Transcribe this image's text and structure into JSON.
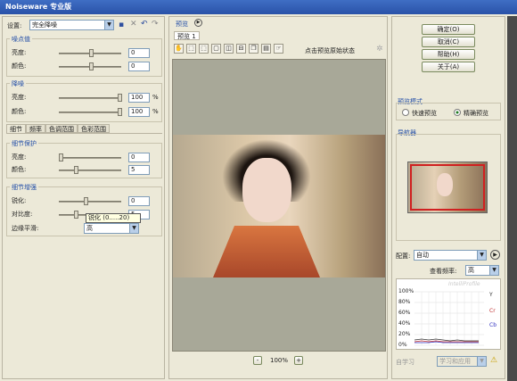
{
  "window": {
    "title": "Noiseware 专业版"
  },
  "settings": {
    "label": "设置:",
    "preset": "完全降噪"
  },
  "threshold": {
    "title": "噪点值",
    "brightness_label": "亮度:",
    "brightness_value": "0",
    "color_label": "颜色:",
    "color_value": "0"
  },
  "denoise": {
    "title": "降噪",
    "brightness_label": "亮度:",
    "brightness_value": "100",
    "brightness_unit": "%",
    "color_label": "颜色:",
    "color_value": "100",
    "color_unit": "%"
  },
  "tabs": [
    "细节",
    "频率",
    "色调范围",
    "色彩范围"
  ],
  "detail_protect": {
    "title": "细节保护",
    "brightness_label": "亮度:",
    "brightness_value": "0",
    "color_label": "颜色:",
    "color_value": "5"
  },
  "detail_enhance": {
    "title": "细节增强",
    "sharpen_label": "锐化:",
    "sharpen_value": "0",
    "contrast_label": "对比度:",
    "contrast_value": "5",
    "edge_label": "边缘平滑:",
    "edge_value": "高",
    "tooltip": "锐化 (0.....20)"
  },
  "preview": {
    "title": "预览",
    "tab": "预览 1",
    "click_hint": "点击预览原始状态",
    "zoom": "100%",
    "zoom_out": "-",
    "zoom_in": "+"
  },
  "buttons": {
    "ok": "确定(O)",
    "cancel": "取消(C)",
    "help": "帮助(H)",
    "about": "关于(A)"
  },
  "preview_mode": {
    "title": "预览模式",
    "fast": "快速预览",
    "accurate": "精确预览",
    "selected": "accurate"
  },
  "navigator": {
    "title": "导航器"
  },
  "config": {
    "label": "配置:",
    "value": "自动",
    "freq_label": "查看频率:",
    "freq_value": "高",
    "brand": "IntelliProfile",
    "learn_label": "自学习",
    "learn_value": "学习和应用",
    "y_ticks": [
      "100%",
      "80%",
      "60%",
      "40%",
      "20%",
      "0%"
    ],
    "legend": [
      "Y",
      "Cr",
      "Cb"
    ]
  },
  "colors": {
    "accent": "#2550a8",
    "titlebar": "#2a52a8",
    "preview_bg": "#a8a898"
  }
}
